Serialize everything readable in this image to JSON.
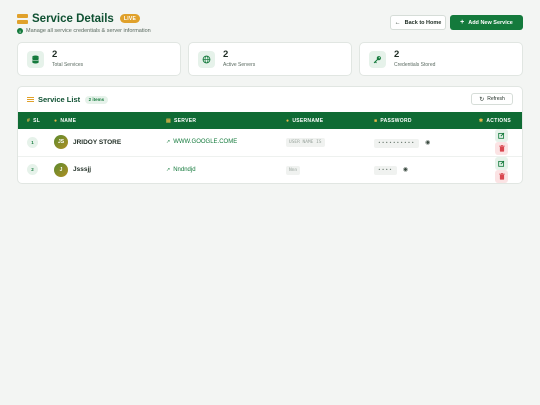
{
  "header": {
    "title": "Service Details",
    "live_badge": "LIVE",
    "subtitle": "Manage all service credentials & server information",
    "back_label": "Back to Home",
    "add_label": "Add New Service"
  },
  "stats": [
    {
      "value": "2",
      "label": "Total Services",
      "icon": "database-icon"
    },
    {
      "value": "2",
      "label": "Active Servers",
      "icon": "globe-icon"
    },
    {
      "value": "2",
      "label": "Credentials Stored",
      "icon": "key-icon"
    }
  ],
  "list": {
    "title": "Service List",
    "count_badge": "2 items",
    "refresh_label": "Refresh",
    "columns": [
      "SL",
      "NAME",
      "SERVER",
      "USERNAME",
      "PASSWORD",
      "ACTIONS"
    ],
    "rows": [
      {
        "sl": "1",
        "initials": "JS",
        "name": "JRIDOY STORE",
        "server": "WWW.GOOGLE.COME",
        "username": "USER NAME IS",
        "password": "••••••••••"
      },
      {
        "sl": "2",
        "initials": "J",
        "name": "Jsssjj",
        "server": "Nndndjd",
        "username": "Nnn",
        "password": "••••"
      }
    ]
  },
  "colors": {
    "primary": "#147a3c",
    "dark_green": "#0f6b34",
    "accent": "#e0a12b",
    "danger": "#d9464f"
  }
}
